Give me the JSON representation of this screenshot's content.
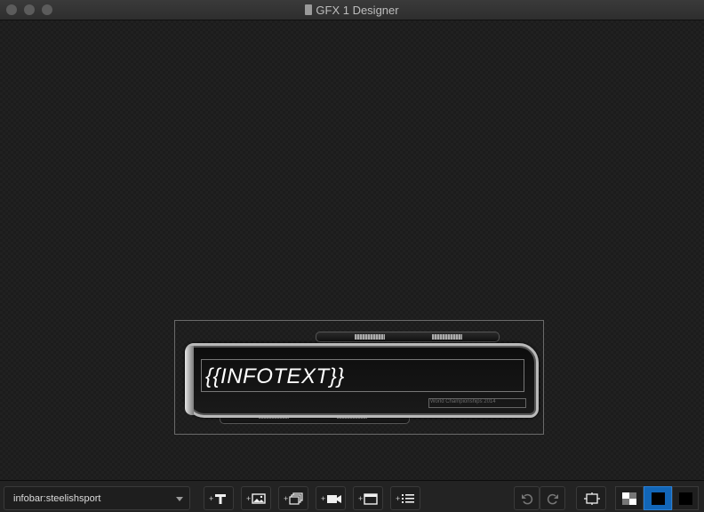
{
  "window": {
    "title": "GFX 1 Designer"
  },
  "canvas": {
    "infotext": "{{INFOTEXT}}",
    "subtext": "World Championships 2014"
  },
  "toolbar": {
    "layer_select": {
      "value": "infobar:steelishsport"
    },
    "add_buttons": [
      {
        "name": "add-text-button",
        "plus": "+",
        "icon": "text-T-icon"
      },
      {
        "name": "add-image-button",
        "plus": "+",
        "icon": "image-icon"
      },
      {
        "name": "add-image-sequence-button",
        "plus": "+",
        "icon": "image-sequence-icon"
      },
      {
        "name": "add-video-button",
        "plus": "+",
        "icon": "video-camera-icon"
      },
      {
        "name": "add-window-button",
        "plus": "+",
        "icon": "window-icon"
      },
      {
        "name": "add-list-button",
        "plus": "+",
        "icon": "list-icon"
      }
    ],
    "undo_icon": "undo-icon",
    "redo_icon": "redo-icon",
    "fit_icon": "fit-to-safe-area-icon",
    "background_options": [
      "checker",
      "blue",
      "black"
    ],
    "background_selected": "blue",
    "accent": "#1266b8"
  }
}
